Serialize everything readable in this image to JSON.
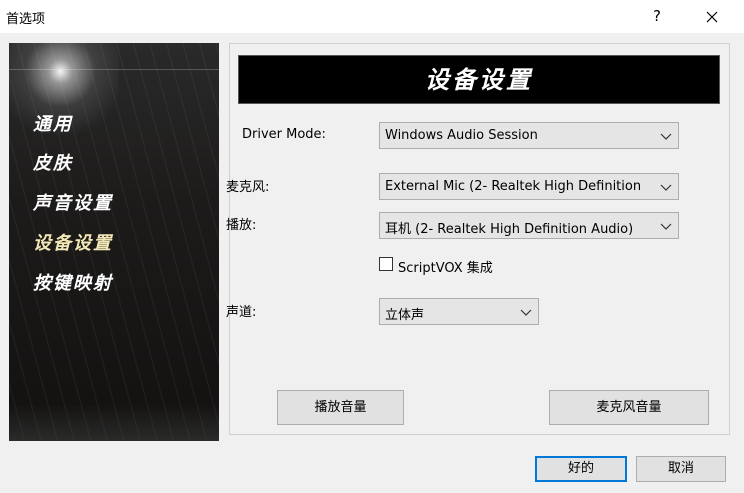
{
  "window": {
    "title": "首选项",
    "help_label": "?"
  },
  "sidebar": {
    "items": [
      {
        "label": "通用"
      },
      {
        "label": "皮肤"
      },
      {
        "label": "声音设置"
      },
      {
        "label": "设备设置"
      },
      {
        "label": "按键映射"
      }
    ],
    "active": "设备设置"
  },
  "main": {
    "header_title": "设备设置",
    "driver_mode": {
      "label": "Driver Mode:",
      "value": "Windows Audio Session"
    },
    "microphone": {
      "label": "麦克风:",
      "value": "External Mic (2- Realtek High Definition"
    },
    "playback": {
      "label": "播放:",
      "value": "耳机 (2- Realtek High Definition Audio)"
    },
    "scriptvox": {
      "label": "ScriptVOX 集成",
      "checked": false
    },
    "channel": {
      "label": "声道:",
      "value": "立体声"
    },
    "playback_volume_button": "播放音量",
    "mic_volume_button": "麦克风音量"
  },
  "footer": {
    "ok_label": "好的",
    "cancel_label": "取消"
  },
  "colors": {
    "accent": "#0078d7",
    "active_nav": "#f2e7b6",
    "header_bg": "#000000"
  }
}
